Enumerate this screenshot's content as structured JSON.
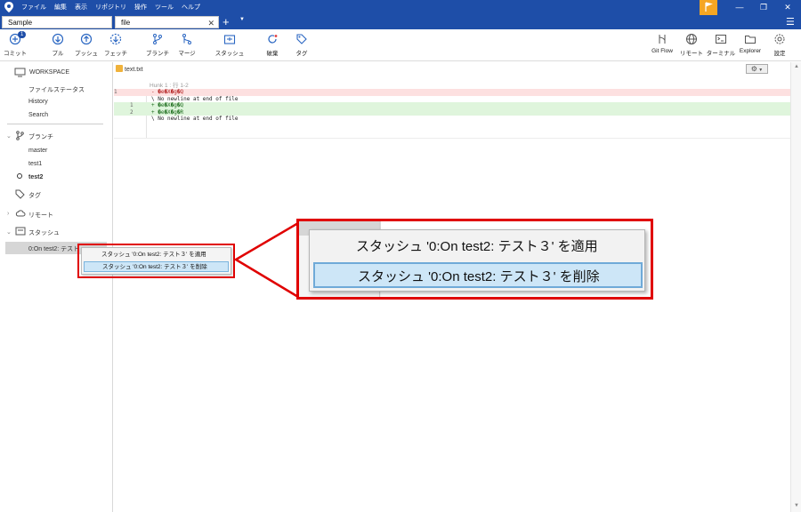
{
  "menu": [
    "ファイル",
    "編集",
    "表示",
    "リポジトリ",
    "操作",
    "ツール",
    "ヘルプ"
  ],
  "tabs": [
    {
      "label": "Sample"
    },
    {
      "label": "file"
    }
  ],
  "toolbar": {
    "commit": "コミット",
    "commit_badge": "1",
    "pull": "プル",
    "push": "プッシュ",
    "fetch": "フェッチ",
    "branch": "ブランチ",
    "merge": "マージ",
    "stash": "スタッシュ",
    "discard": "破棄",
    "tag": "タグ",
    "gitflow": "Git Flow",
    "remote": "リモート",
    "terminal": "ターミナル",
    "explorer": "Explorer",
    "settings": "設定"
  },
  "sidebar": {
    "workspace": "WORKSPACE",
    "workspace_items": [
      "ファイルステータス",
      "History",
      "Search"
    ],
    "branches": "ブランチ",
    "branch_items": [
      "master",
      "test1",
      "test2"
    ],
    "tags": "タグ",
    "remotes": "リモート",
    "stashes": "スタッシュ",
    "stash_item": "0:On test2: テスト"
  },
  "file": {
    "name": "text.txt"
  },
  "diff": {
    "hunk": "Hunk 1 : 行 1-2",
    "lines": [
      {
        "type": "del",
        "n1": "1",
        "n2": "",
        "text": "- �e�X�g�Q"
      },
      {
        "type": "ctx",
        "n1": "",
        "n2": "",
        "text": "\\  No newline at end of file"
      },
      {
        "type": "add",
        "n1": "",
        "n2": "1",
        "text": "+ �e�X�g�Q"
      },
      {
        "type": "add",
        "n1": "",
        "n2": "2",
        "text": "+ �e�X�g�R"
      },
      {
        "type": "ctx",
        "n1": "",
        "n2": "",
        "text": "\\  No newline at end of file"
      }
    ]
  },
  "context_menu": {
    "apply": "スタッシュ '0:On test2: テスト３' を適用",
    "delete": "スタッシュ '0:On test2: テスト３' を削除"
  },
  "colors": {
    "titlebar": "#1e4ea8",
    "accent": "#2a66c2",
    "highlight": "#e00000",
    "flag": "#f5a623"
  }
}
